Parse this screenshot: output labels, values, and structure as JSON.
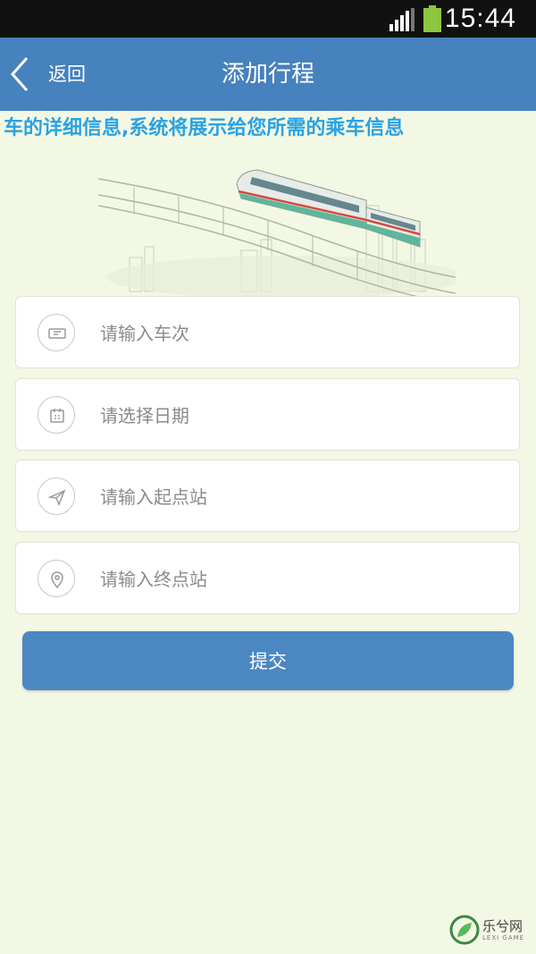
{
  "status_bar": {
    "time": "15:44"
  },
  "header": {
    "back_label": "返回",
    "title": "添加行程"
  },
  "notice": {
    "text": "车的详细信息,系统将展示给您所需的乘车信息"
  },
  "form": {
    "fields": [
      {
        "placeholder": "请输入车次",
        "icon": "ticket-icon"
      },
      {
        "placeholder": "请选择日期",
        "icon": "calendar-icon"
      },
      {
        "placeholder": "请输入起点站",
        "icon": "send-icon"
      },
      {
        "placeholder": "请输入终点站",
        "icon": "location-pin-icon"
      }
    ],
    "submit_label": "提交"
  },
  "watermark": {
    "text": "乐兮网",
    "subtext": "LEXI GAME"
  },
  "colors": {
    "header": "#4682bd",
    "accent_text": "#2aa2e4",
    "background": "#f3f8e4",
    "button": "#4b88c3"
  }
}
